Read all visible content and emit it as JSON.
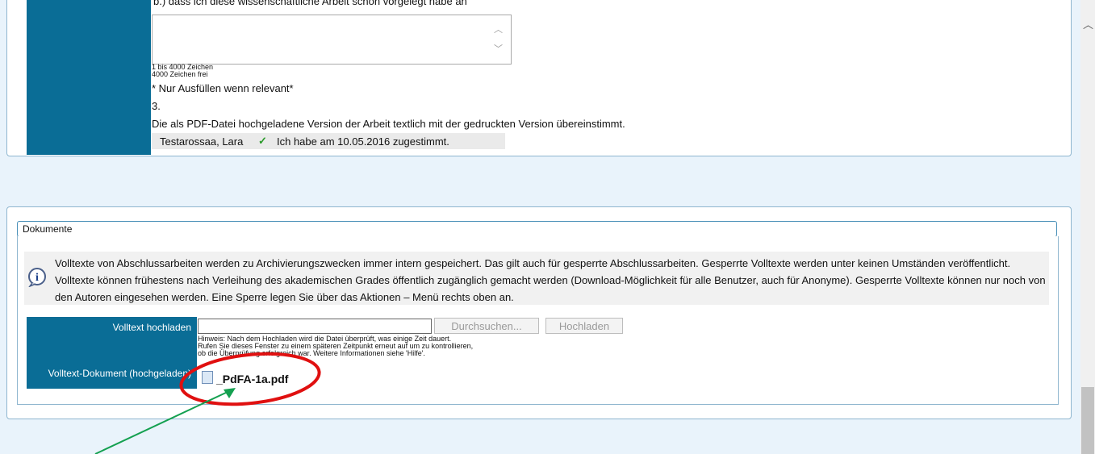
{
  "top_form": {
    "cut_question": "b.)  dass ich diese wissenschaftliche Arbeit schon vorgelegt habe an",
    "counter_range": "1 bis 4000 Zeichen",
    "counter_free": "4000 Zeichen frei",
    "relevant_note": "* Nur Ausfüllen wenn relevant*",
    "item_number": "3.",
    "statement": "Die als PDF-Datei hochgeladene Version der Arbeit textlich mit der gedruckten Version übereinstimmt.",
    "consent": {
      "name": "Testarossaa, Lara",
      "check_glyph": "✓",
      "text": "Ich habe am 10.05.2016 zugestimmt."
    }
  },
  "documents": {
    "legend": "Dokumente",
    "info_text": "Volltexte von Abschlussarbeiten werden zu Archivierungszwecken immer intern gespeichert. Das gilt auch für gesperrte Abschlussarbeiten. Gesperrte Volltexte werden unter keinen Umständen veröffentlicht. Volltexte können frühestens nach Verleihung des akademischen Grades öffentlich zugänglich gemacht werden (Download-Möglichkeit für alle Benutzer, auch für Anonyme). Gesperrte Volltexte können nur noch von den Autoren eingesehen werden. Eine Sperre legen Sie über das Aktionen – Menü rechts oben an.",
    "upload_label": "Volltext hochladen",
    "browse_button": "Durchsuchen...",
    "upload_button": "Hochladen",
    "hint_line1": "Hinweis: Nach dem Hochladen wird die Datei überprüft, was einige Zeit dauert.",
    "hint_line2": "Rufen Sie dieses Fenster zu einem späteren Zeitpunkt erneut auf um zu kontrollieren,",
    "hint_line3": "ob die Überprüfung erfolgreich war. Weitere Informationen siehe 'Hilfe'.",
    "doc_label": "Volltext-Dokument (hochgeladen)",
    "file_name": "_PdFA-1a.pdf"
  },
  "colors": {
    "accent_blue": "#0a6d96",
    "annotation_red": "#e01010",
    "annotation_green": "#14a050"
  },
  "icons": [
    "info-icon",
    "checkmark-icon",
    "document-icon",
    "scroll-up-arrow-icon"
  ]
}
